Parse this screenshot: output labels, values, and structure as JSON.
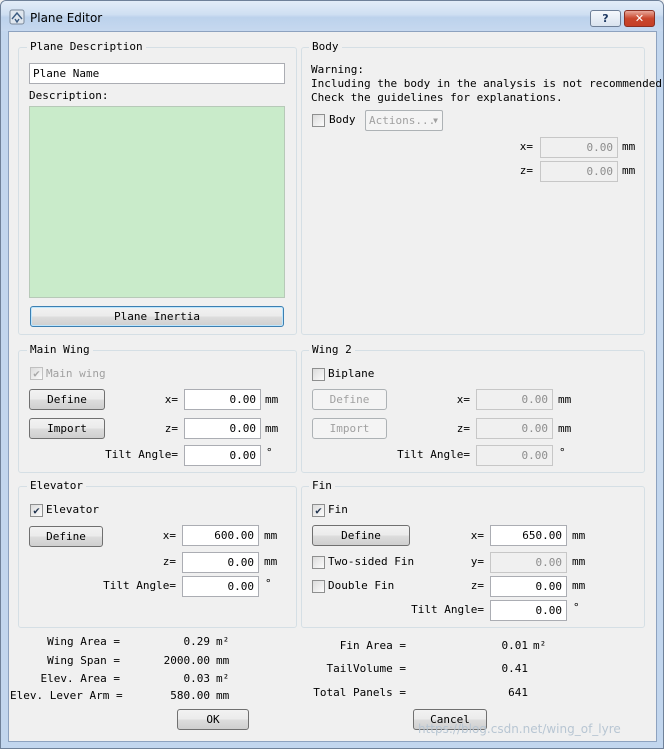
{
  "window": {
    "title": "Plane Editor",
    "help_glyph": "?",
    "close_glyph": "✕",
    "app_icon": "plane-app-icon"
  },
  "plane_description": {
    "group_title": "Plane Description",
    "name_value": "Plane Name",
    "description_label": "Description:",
    "description_value": "",
    "inertia_button": "Plane Inertia"
  },
  "body": {
    "group_title": "Body",
    "warning_line1": "Warning:",
    "warning_line2": "Including the body in the analysis is not recommended.",
    "warning_line3": "Check the guidelines for explanations.",
    "checkbox_label": "Body",
    "checked": false,
    "actions_label": "Actions...",
    "x_label": "x=",
    "x_value": "0.00",
    "z_label": "z=",
    "z_value": "0.00",
    "unit": "mm"
  },
  "main_wing": {
    "group_title": "Main Wing",
    "checkbox_label": "Main wing",
    "checked": true,
    "define_button": "Define",
    "import_button": "Import",
    "x_label": "x=",
    "x_value": "0.00",
    "z_label": "z=",
    "z_value": "0.00",
    "tilt_label": "Tilt Angle=",
    "tilt_value": "0.00",
    "unit": "mm",
    "deg": "°"
  },
  "wing2": {
    "group_title": "Wing 2",
    "checkbox_label": "Biplane",
    "checked": false,
    "define_button": "Define",
    "import_button": "Import",
    "x_label": "x=",
    "x_value": "0.00",
    "z_label": "z=",
    "z_value": "0.00",
    "tilt_label": "Tilt Angle=",
    "tilt_value": "0.00",
    "unit": "mm",
    "deg": "°"
  },
  "elevator": {
    "group_title": "Elevator",
    "checkbox_label": "Elevator",
    "checked": true,
    "define_button": "Define",
    "x_label": "x=",
    "x_value": "600.00",
    "z_label": "z=",
    "z_value": "0.00",
    "tilt_label": "Tilt Angle=",
    "tilt_value": "0.00",
    "unit": "mm",
    "deg": "°"
  },
  "fin": {
    "group_title": "Fin",
    "checkbox_label": "Fin",
    "checked": true,
    "define_button": "Define",
    "two_sided_label": "Two-sided Fin",
    "two_sided_checked": false,
    "double_label": "Double Fin",
    "double_checked": false,
    "x_label": "x=",
    "x_value": "650.00",
    "y_label": "y=",
    "y_value": "0.00",
    "z_label": "z=",
    "z_value": "0.00",
    "tilt_label": "Tilt Angle=",
    "tilt_value": "0.00",
    "unit": "mm",
    "deg": "°"
  },
  "stats_left": [
    {
      "label": "Wing Area =",
      "value": "0.29",
      "unit": "m²"
    },
    {
      "label": "Wing Span =",
      "value": "2000.00",
      "unit": "mm"
    },
    {
      "label": "Elev. Area =",
      "value": "0.03",
      "unit": "m²"
    },
    {
      "label": "Elev. Lever Arm =",
      "value": "580.00",
      "unit": "mm"
    }
  ],
  "stats_right": [
    {
      "label": "Fin Area =",
      "value": "0.01",
      "unit": "m²"
    },
    {
      "label": "TailVolume =",
      "value": "0.41",
      "unit": ""
    },
    {
      "label": "Total Panels =",
      "value": "641",
      "unit": ""
    }
  ],
  "buttons": {
    "ok": "OK",
    "cancel": "Cancel"
  },
  "watermark": "https://blog.csdn.net/wing_of_lyre",
  "check_glyph": "✔"
}
